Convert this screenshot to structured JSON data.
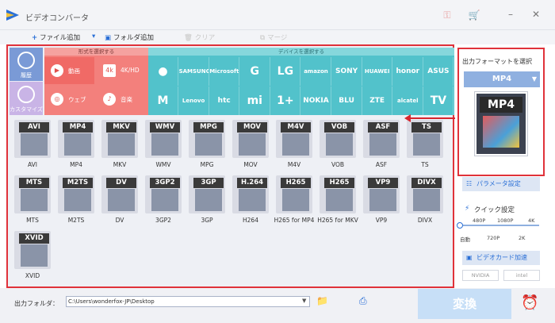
{
  "app": {
    "title": "ビデオコンバータ"
  },
  "toolbar": {
    "add_file": "ファイル追加",
    "add_folder": "フォルダ追加",
    "clear": "クリア",
    "merge": "マージ"
  },
  "sidebar": {
    "history": "履歴",
    "custom": "カスタマイズ"
  },
  "format_section": {
    "header": "形式を選択する",
    "items": [
      "動画",
      "4K/HD",
      "ウェブ",
      "音楽"
    ]
  },
  "device_section": {
    "header": "デバイスを選択する",
    "row1": [
      "",
      "SAMSUNG",
      "Microsoft",
      "G",
      "LG",
      "amazon",
      "SONY",
      "HUAWEI",
      "honor",
      "ASUS"
    ],
    "row2": [
      "M",
      "Lenovo",
      "htc",
      "mi",
      "1+",
      "NOKIA",
      "BLU",
      "ZTE",
      "alcatel",
      "TV"
    ]
  },
  "formats": [
    {
      "tag": "AVI",
      "name": "AVI"
    },
    {
      "tag": "MP4",
      "name": "MP4"
    },
    {
      "tag": "MKV",
      "name": "MKV"
    },
    {
      "tag": "WMV",
      "name": "WMV"
    },
    {
      "tag": "MPG",
      "name": "MPG"
    },
    {
      "tag": "MOV",
      "name": "MOV"
    },
    {
      "tag": "M4V",
      "name": "M4V"
    },
    {
      "tag": "VOB",
      "name": "VOB"
    },
    {
      "tag": "ASF",
      "name": "ASF"
    },
    {
      "tag": "TS",
      "name": "TS"
    },
    {
      "tag": "MTS",
      "name": "MTS"
    },
    {
      "tag": "M2TS",
      "name": "M2TS"
    },
    {
      "tag": "DV",
      "name": "DV"
    },
    {
      "tag": "3GP2",
      "name": "3GP2"
    },
    {
      "tag": "3GP",
      "name": "3GP"
    },
    {
      "tag": "H.264",
      "name": "H264"
    },
    {
      "tag": "H265",
      "name": "H265 for MP4"
    },
    {
      "tag": "H265",
      "name": "H265 for MKV"
    },
    {
      "tag": "VP9",
      "name": "VP9"
    },
    {
      "tag": "DIVX",
      "name": "DIVX"
    },
    {
      "tag": "XVID",
      "name": "XVID"
    }
  ],
  "output_panel": {
    "title": "出力フォーマットを選択",
    "selected": "MP4",
    "preview_tag": "MP4",
    "param_button": "パラメータ設定",
    "quick_label": "クイック設定",
    "slider_top": [
      "480P",
      "1080P",
      "4K"
    ],
    "slider_bottom": [
      "自動",
      "720P",
      "2K"
    ],
    "gpu_button": "ビデオカード加速",
    "vendors": [
      "NVIDIA",
      "intel"
    ]
  },
  "bottom": {
    "output_label": "出力フォルダ：",
    "output_path": "C:\\Users\\wonderfox-JP\\Desktop",
    "convert": "変換"
  },
  "colors": {
    "accent": "#2a6fd6",
    "highlight": "#e0323a",
    "format_block": "#f3807c",
    "device_block": "#52c2cb",
    "convert_disabled": "#c7dff7"
  }
}
